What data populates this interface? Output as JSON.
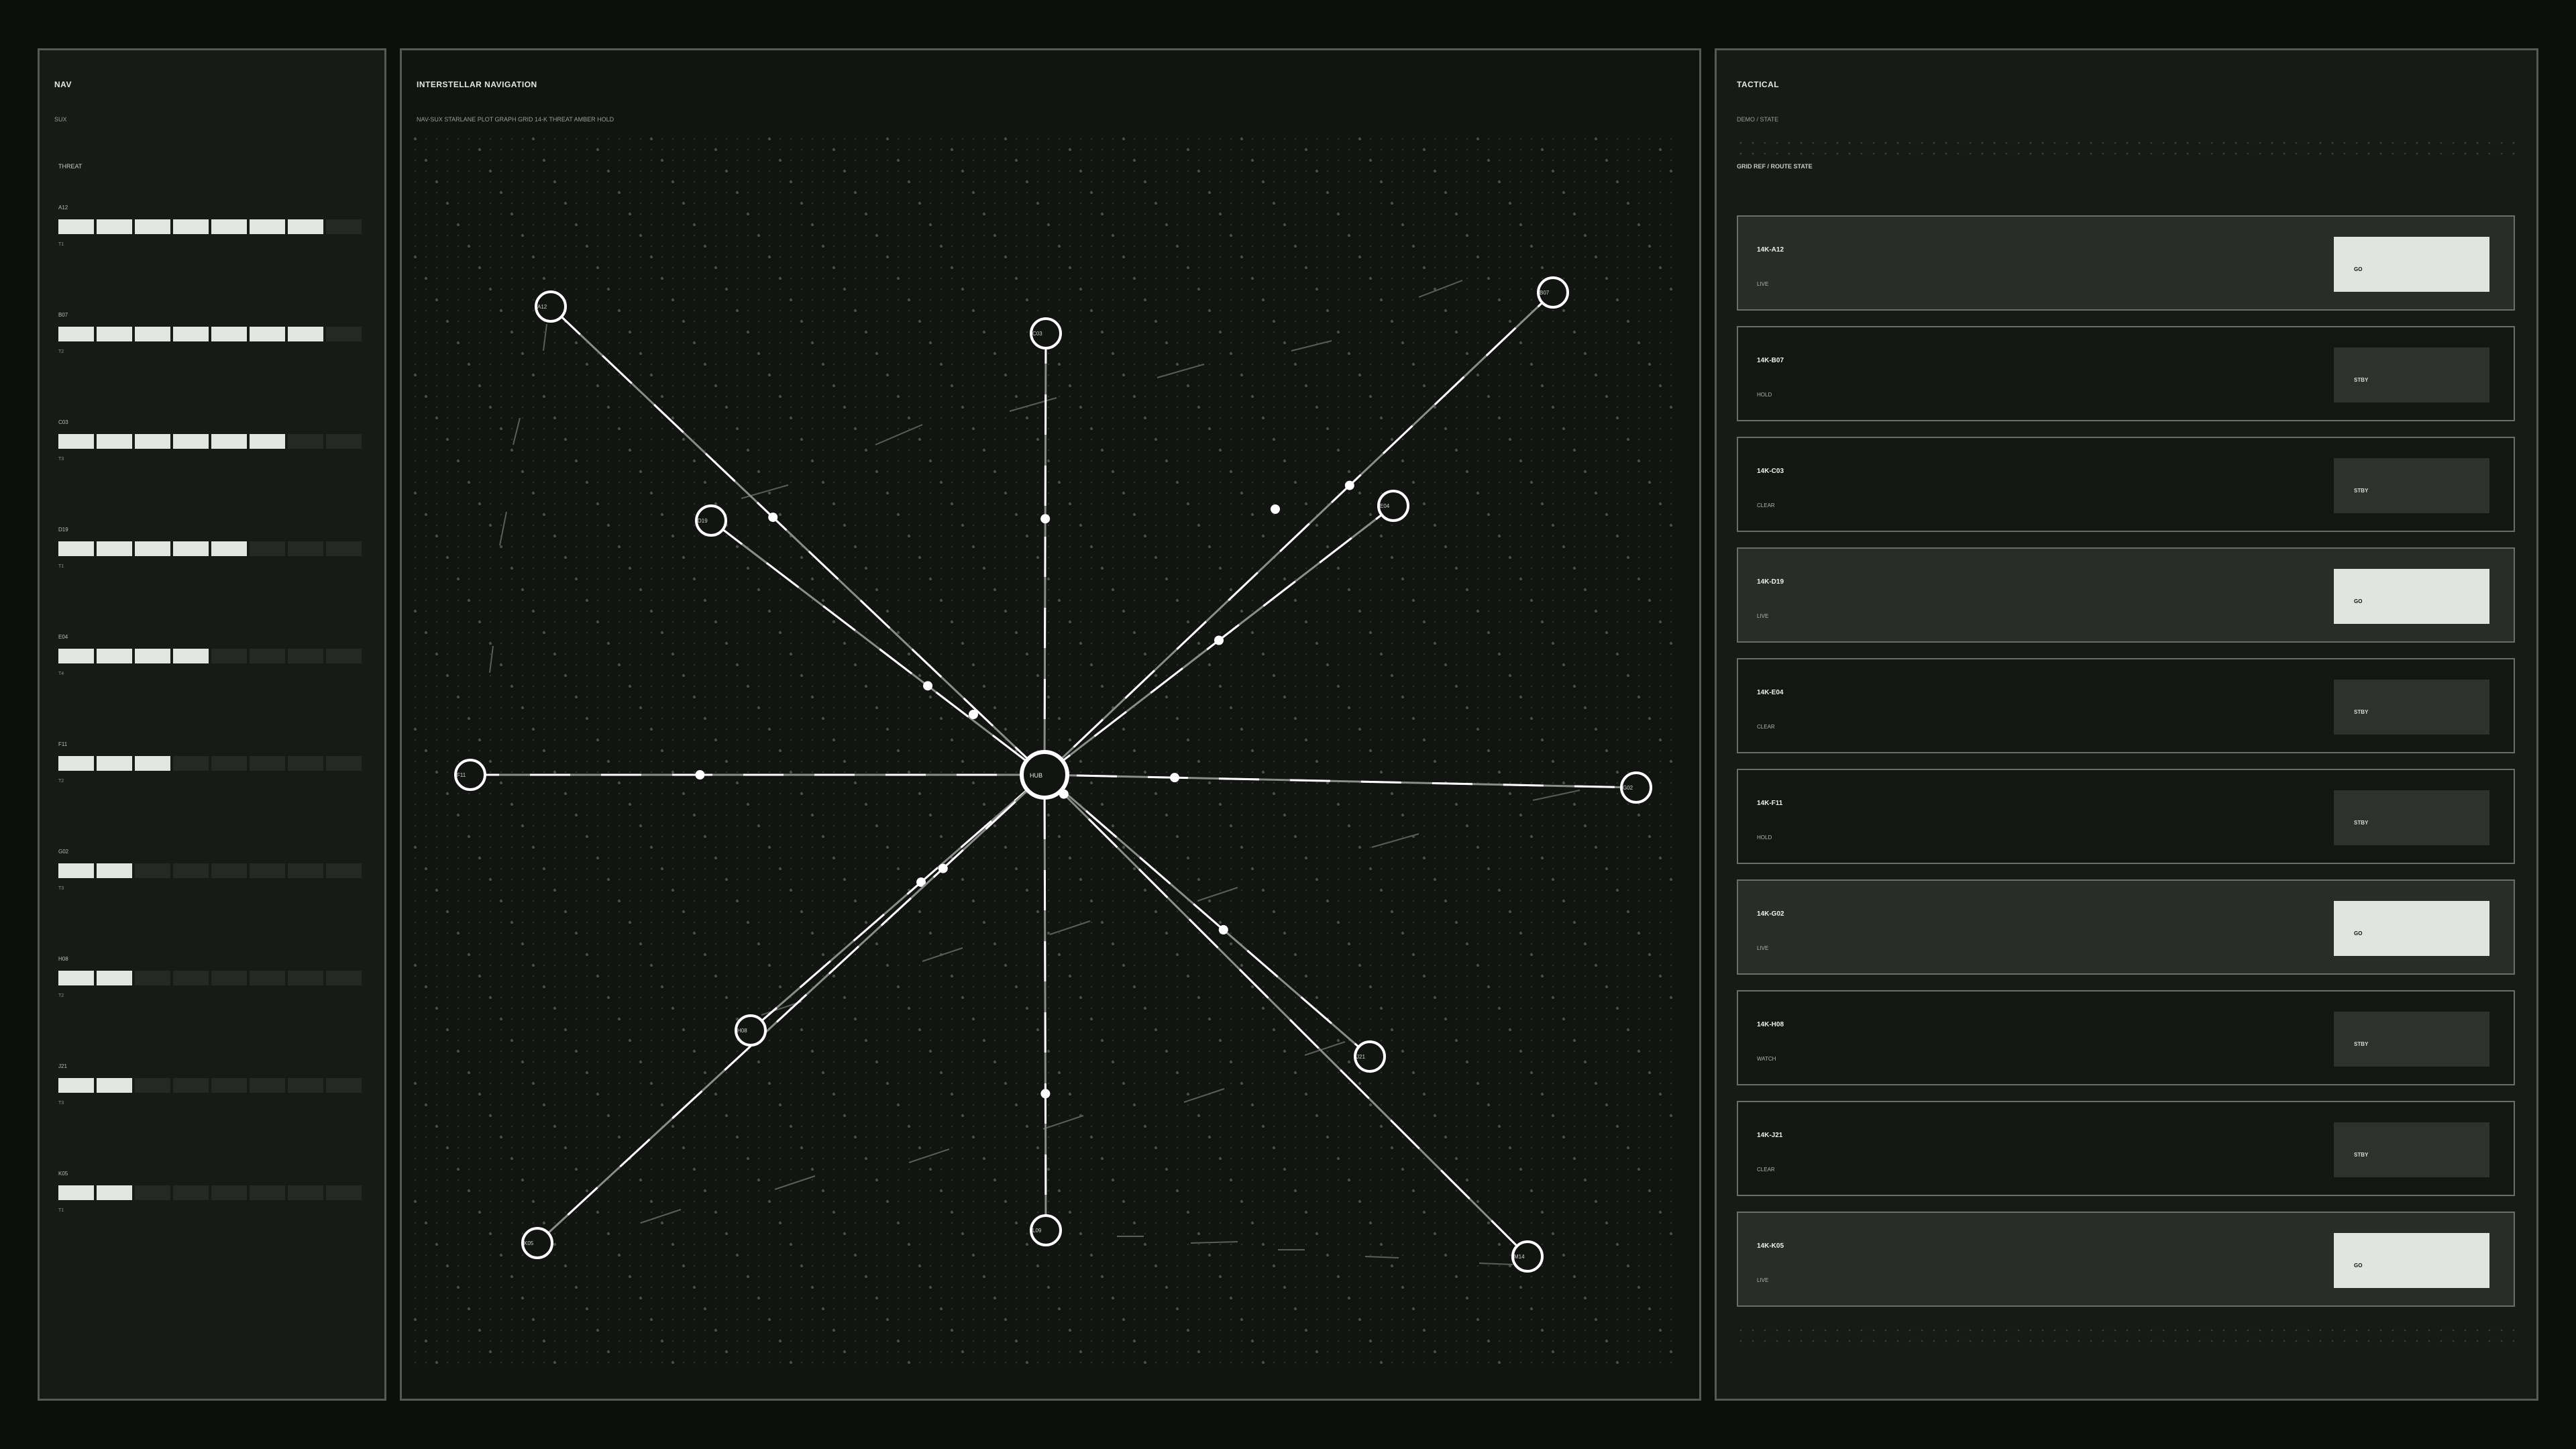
{
  "left": {
    "title": "NAV",
    "subtitle": "SUX",
    "section": "THREAT",
    "threats": [
      {
        "id": "A12",
        "level": "T1",
        "fill": 7
      },
      {
        "id": "B07",
        "level": "T2",
        "fill": 7
      },
      {
        "id": "C03",
        "level": "T3",
        "fill": 6
      },
      {
        "id": "D19",
        "level": "T1",
        "fill": 5
      },
      {
        "id": "E04",
        "level": "T4",
        "fill": 4
      },
      {
        "id": "F11",
        "level": "T2",
        "fill": 3
      },
      {
        "id": "G02",
        "level": "T3",
        "fill": 2
      },
      {
        "id": "H08",
        "level": "T2",
        "fill": 2
      },
      {
        "id": "J21",
        "level": "T3",
        "fill": 2
      },
      {
        "id": "K05",
        "level": "T1",
        "fill": 2
      }
    ],
    "bar_total": 8
  },
  "center": {
    "title": "INTERSTELLAR NAVIGATION",
    "subtitle": "NAV-SUX STARLANE PLOT GRAPH   GRID 14-K   THREAT AMBER HOLD",
    "hub_label": "HUB",
    "nodes": [
      {
        "label": "A12"
      },
      {
        "label": "C03"
      },
      {
        "label": "B07"
      },
      {
        "label": "D19"
      },
      {
        "label": "E04"
      },
      {
        "label": "F11"
      },
      {
        "label": "G02"
      },
      {
        "label": "H08"
      },
      {
        "label": "J21"
      },
      {
        "label": "K05"
      },
      {
        "label": "L09"
      },
      {
        "label": "M14"
      }
    ]
  },
  "right": {
    "title": "TACTICAL",
    "subtitle": "DEMO / STATE",
    "section": "GRID REF  /  ROUTE STATE",
    "routes": [
      {
        "id": "14K-A12",
        "status": "LIVE",
        "action": "GO",
        "kind": "go"
      },
      {
        "id": "14K-B07",
        "status": "HOLD",
        "action": "STBY",
        "kind": "stby"
      },
      {
        "id": "14K-C03",
        "status": "CLEAR",
        "action": "STBY",
        "kind": "stby"
      },
      {
        "id": "14K-D19",
        "status": "LIVE",
        "action": "GO",
        "kind": "go"
      },
      {
        "id": "14K-E04",
        "status": "CLEAR",
        "action": "STBY",
        "kind": "stby"
      },
      {
        "id": "14K-F11",
        "status": "HOLD",
        "action": "STBY",
        "kind": "stby"
      },
      {
        "id": "14K-G02",
        "status": "LIVE",
        "action": "GO",
        "kind": "go"
      },
      {
        "id": "14K-H08",
        "status": "WATCH",
        "action": "STBY",
        "kind": "stby"
      },
      {
        "id": "14K-J21",
        "status": "CLEAR",
        "action": "STBY",
        "kind": "stby"
      },
      {
        "id": "14K-K05",
        "status": "LIVE",
        "action": "GO",
        "kind": "go"
      }
    ]
  },
  "colors": {
    "background": "#0d0f0d",
    "panel": "#181a18",
    "accent": "#e3e5e1",
    "border": "#555a56"
  }
}
